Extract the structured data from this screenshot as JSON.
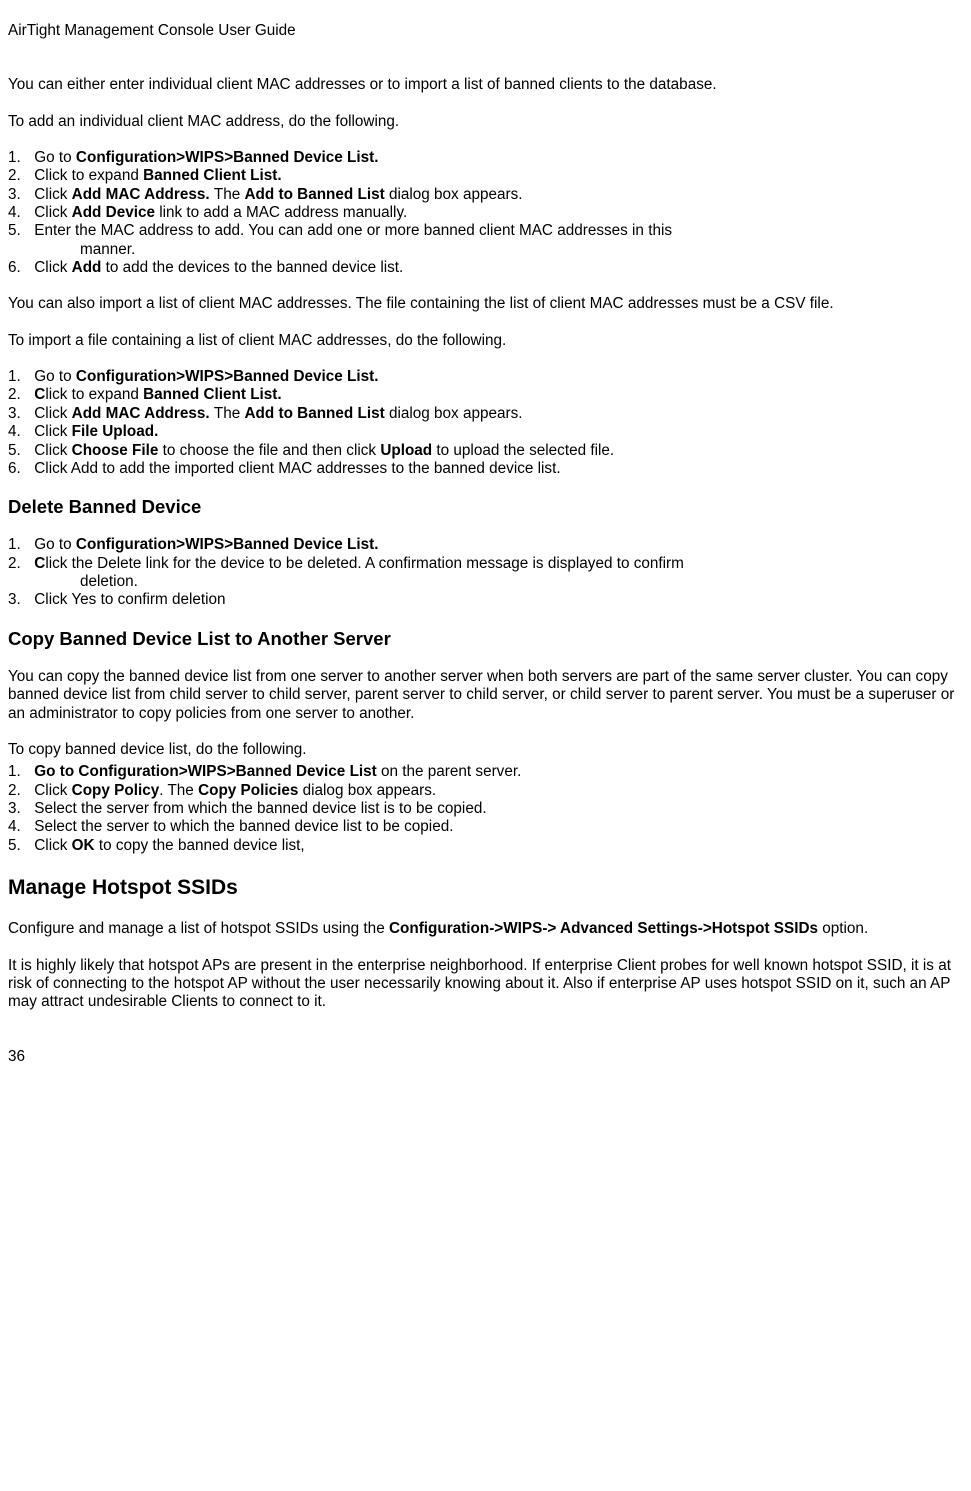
{
  "header": "AirTight Management Console User Guide",
  "intro1": "You can either enter individual client MAC addresses or to import a list of banned clients to the database.",
  "intro2": "To add an individual client MAC address, do the following.",
  "list1": {
    "i1a": "Go to ",
    "i1b": "Configuration>WIPS>Banned Device List.",
    "i2a": "Click to expand ",
    "i2b": "Banned Client List.",
    "i3a": "Click ",
    "i3b": "Add MAC Address. ",
    "i3c": "The ",
    "i3d": "Add to Banned List ",
    "i3e": "dialog box appears.",
    "i4a": "Click ",
    "i4b": "Add Device ",
    "i4c": "link to add a MAC address manually.",
    "i5a": "Enter the MAC address to add. You can add one or more banned client MAC addresses in this",
    "i5b": "manner.",
    "i6a": "Click ",
    "i6b": "Add ",
    "i6c": "to add the devices to the banned device list."
  },
  "para2": "You can also import a list of client MAC addresses. The file containing the list of client MAC addresses must be a CSV file.",
  "para3": "To import a file containing a list of client MAC addresses, do the following.",
  "list2": {
    "i1a": "Go to ",
    "i1b": "Configuration>WIPS>Banned Device List.",
    "i2a": "C",
    "i2b": "lick to expand ",
    "i2c": "Banned Client List.",
    "i3a": "Click ",
    "i3b": "Add MAC Address. ",
    "i3c": "The ",
    "i3d": "Add to Banned List ",
    "i3e": "dialog box appears.",
    "i4a": "Click ",
    "i4b": "File Upload.",
    "i5a": "Click ",
    "i5b": "Choose File ",
    "i5c": "to choose the file and then click ",
    "i5d": "Upload ",
    "i5e": "to upload the selected file.",
    "i6": "Click Add to add the imported client MAC addresses to the banned device list."
  },
  "h2a": "Delete Banned Device",
  "list3": {
    "i1a": "Go to ",
    "i1b": "Configuration>WIPS>Banned Device List.",
    "i2a": "C",
    "i2b": "lick the Delete link for the device to be deleted. A confirmation message is displayed to confirm",
    "i2c": "deletion.",
    "i3": "Click Yes to confirm deletion"
  },
  "h2b": "Copy Banned Device List to Another Server",
  "para4": "You can copy the banned device list from one server to another server when both servers are part of the same server cluster. You can copy banned device list from child server to child server, parent server to child server, or child server to parent server. You must be a superuser or an administrator to copy policies from one server to another.",
  "para5": "To copy banned device list, do the following.",
  "list4": {
    "i1a": "Go to Configuration>WIPS>Banned Device List ",
    "i1b": "on the parent server.",
    "i2a": "Click ",
    "i2b": "Copy Policy",
    "i2c": ". The ",
    "i2d": "Copy Policies ",
    "i2e": "dialog box appears.",
    "i3": "Select the server from which the banned device list is to be copied.",
    "i4": "Select the server to which the banned device list to be copied.",
    "i5a": "Click ",
    "i5b": "OK ",
    "i5c": "to copy the banned device list,"
  },
  "h1a": "Manage Hotspot SSIDs",
  "para6a": "Configure and manage a list of hotspot SSIDs using the ",
  "para6b": "Configuration->WIPS-> Advanced Settings->Hotspot SSIDs ",
  "para6c": "option.",
  "para7": "It is highly likely that hotspot APs are present in the enterprise neighborhood. If enterprise Client probes for well known hotspot SSID, it is at risk of connecting to the hotspot AP without the user necessarily knowing about it. Also if enterprise AP uses hotspot SSID on it, such an AP may attract undesirable Clients to connect to it.",
  "pagenum": "36"
}
